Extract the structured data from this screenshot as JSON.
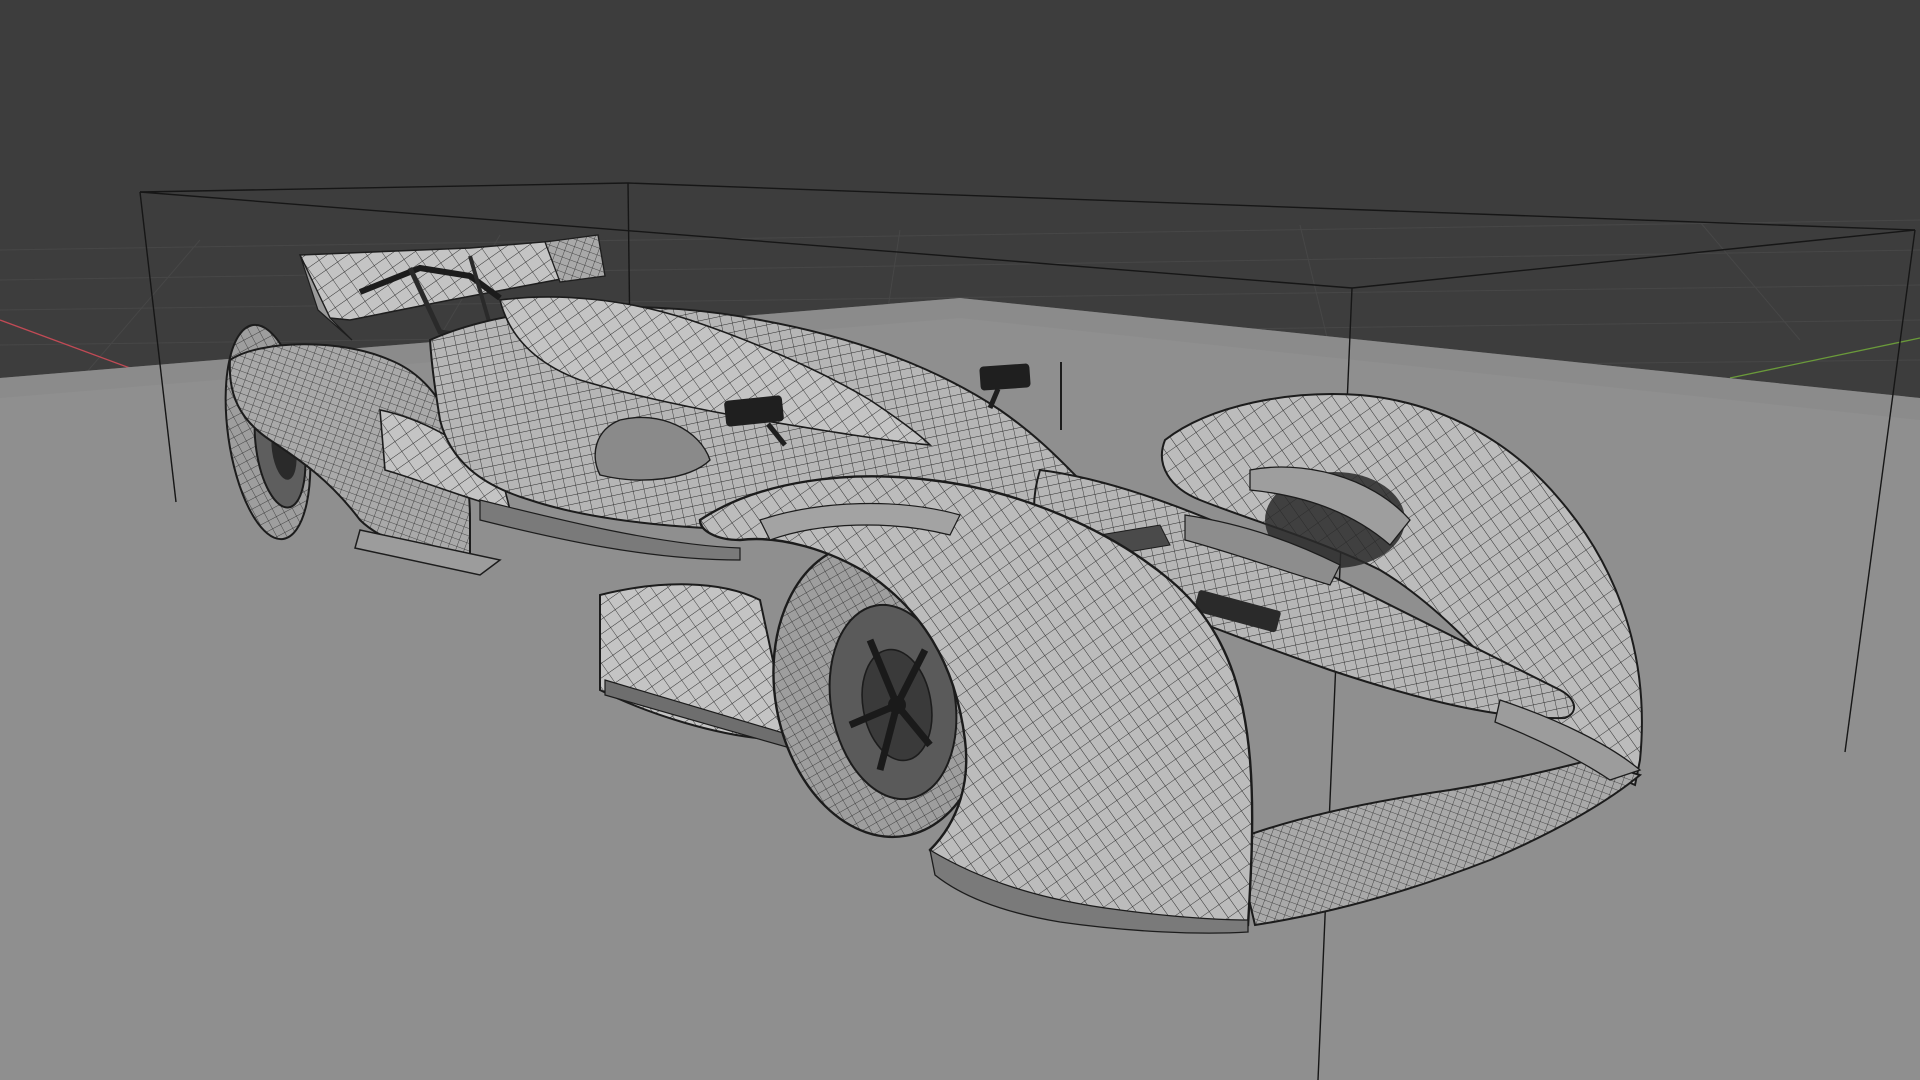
{
  "viewport": {
    "view_mode": "wireframe-overlay",
    "object": "race-car-mesh",
    "colors": {
      "background": "#3d3d3d",
      "grid_line": "#4a4a4a",
      "floor": "#8f8f8f",
      "floor_shadow": "#858585",
      "bounding_box": "#161616",
      "mesh_surface": "#b4b4b4",
      "mesh_light": "#c6c6c6",
      "mesh_dark": "#6e6e6e",
      "wire": "#2a2a2a",
      "tire": "#9a9a9a",
      "wheel_well": "#1e1e1e",
      "x_axis": "#c04a55",
      "y_axis": "#6a9a3a"
    },
    "icons": [
      "x-axis-line",
      "y-axis-line",
      "bounding-box",
      "floor-plane",
      "car-mesh"
    ]
  }
}
